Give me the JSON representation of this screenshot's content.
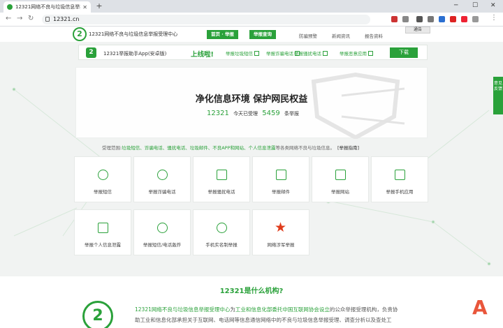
{
  "browser": {
    "tab_title": "12321网络不良与垃圾信息举报受理中心",
    "url": "12321.cn",
    "bookmark": "通告",
    "win_min": "─",
    "win_max": "☐",
    "win_close": "✕"
  },
  "header": {
    "site_title": "12321网络不良与垃圾信息举报受理中心",
    "nav": [
      "首页 · 举报",
      "举报查询",
      "防骗预警",
      "新闻资讯",
      "报告资料"
    ]
  },
  "appbar": {
    "text": "12321举报助手App(安卓版)",
    "highlight": "上线啦!",
    "checks": [
      "举报垃圾短信",
      "举报诈骗电话",
      "举报骚扰电话",
      "举报恶意应用"
    ],
    "download": "下载"
  },
  "hero": {
    "title": "净化信息环境 保护网民权益",
    "today_count": "12321",
    "today_label": "今天已受理",
    "total_count": "5459",
    "total_label": "条举报"
  },
  "scope": {
    "label": "受理范围:",
    "items": "垃圾短信、诈骗电话、骚扰电话、垃圾邮件、不良APP和网站、个人信息泄露",
    "tail": "等各类网络不良与垃圾信息。",
    "guide": "[举报指南]"
  },
  "cards": [
    {
      "label": "举报短信",
      "icon": "message-icon"
    },
    {
      "label": "举报诈骗电话",
      "icon": "scam-call-icon"
    },
    {
      "label": "举报骚扰电话",
      "icon": "phone-icon"
    },
    {
      "label": "举报邮件",
      "icon": "mail-icon"
    },
    {
      "label": "举报网站",
      "icon": "website-icon"
    },
    {
      "label": "举报手机应用",
      "icon": "app-icon"
    },
    {
      "label": "举报个人信息泄露",
      "icon": "id-card-icon"
    },
    {
      "label": "举报短信/电话轰炸",
      "icon": "bomb-icon"
    },
    {
      "label": "手机实名制举报",
      "icon": "user-phone-icon"
    },
    {
      "label": "网络涉军举报",
      "icon": "star-icon"
    }
  ],
  "about": {
    "heading": "12321是什么机构?",
    "p1_a": "12321网络不良与垃圾信息举报受理中心",
    "p1_b": "为",
    "p1_c": "工业和信息化部委托中国互联网协会设立",
    "p1_d": "的公众举报受理机构，负责协",
    "p2": "助工业和信息化部承担关于互联网、电话网等信息通信网络中的不良与垃圾信息举报受理、调查分析以及查处工"
  },
  "side_tab": "意见反馈"
}
